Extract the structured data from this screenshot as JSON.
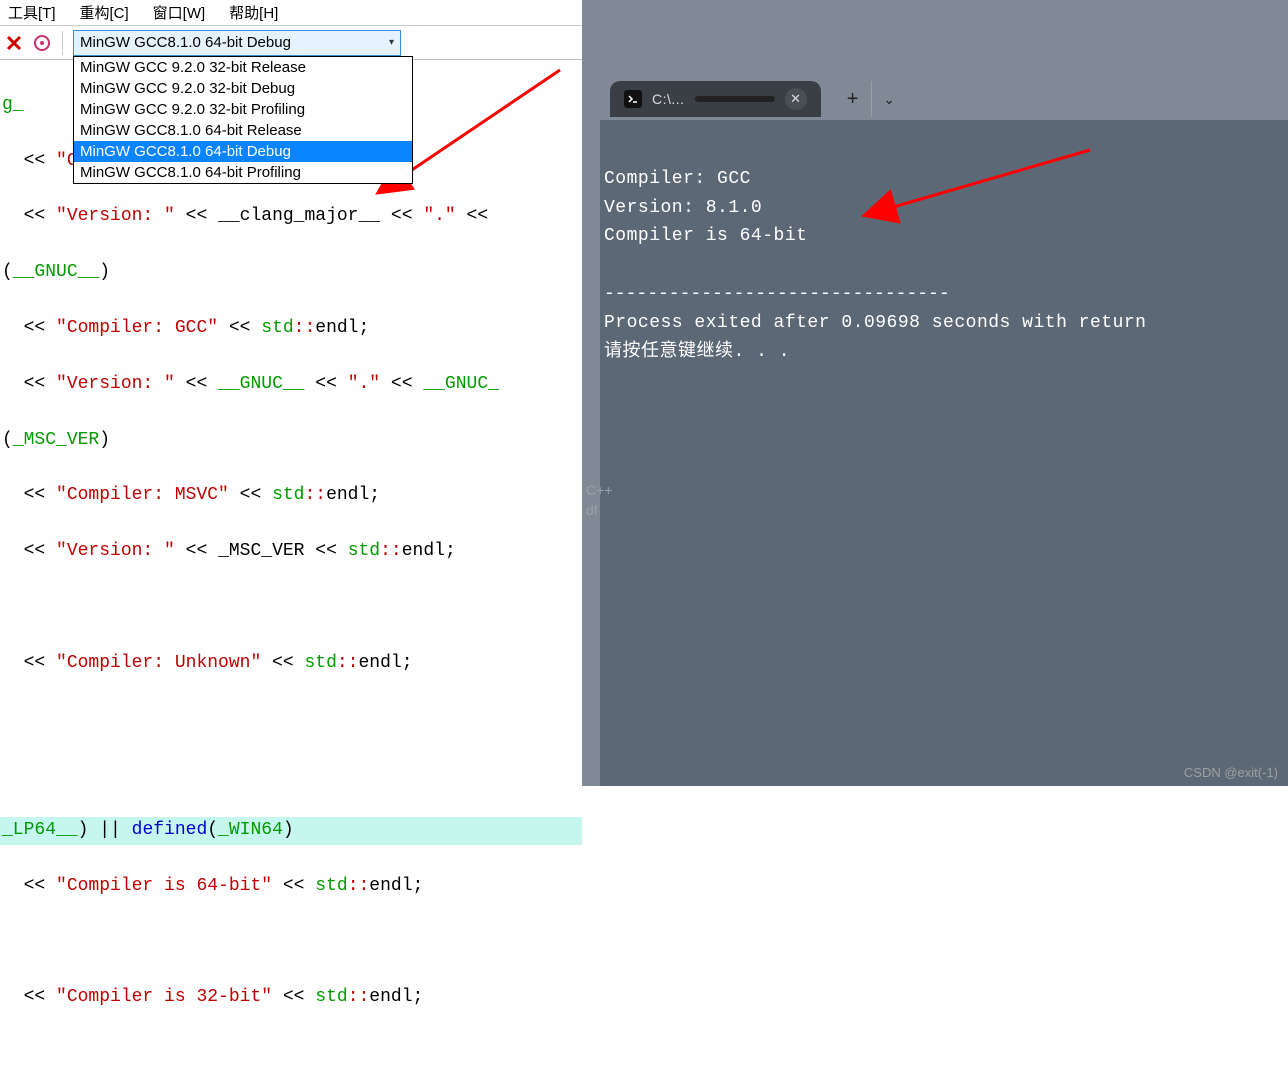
{
  "menubar": {
    "tools": "工具[T]",
    "refactor": "重构[C]",
    "window": "窗口[W]",
    "help": "帮助[H]"
  },
  "combo": {
    "selected": "MinGW GCC8.1.0 64-bit Debug",
    "options": [
      "MinGW GCC 9.2.0 32-bit Release",
      "MinGW GCC 9.2.0 32-bit Debug",
      "MinGW GCC 9.2.0 32-bit Profiling",
      "MinGW GCC8.1.0 64-bit Release",
      "MinGW GCC8.1.0 64-bit Debug",
      "MinGW GCC8.1.0 64-bit Profiling"
    ],
    "selected_index": 4
  },
  "code": {
    "frag_g": "g_",
    "l1_str": "\"Compiler: Clang\"",
    "l2_str": "\"Version: \"",
    "l2_id": "__clang_major__",
    "l2_dot": "\".\"",
    "gnuc": "__GNUC__",
    "l4_str": "\"Compiler: GCC\"",
    "l5_str": "\"Version: \"",
    "l5_dot": "\".\"",
    "l5_id2": "__GNUC_",
    "mscver": "_MSC_VER",
    "l7_str": "\"Compiler: MSVC\"",
    "l8_str": "\"Version: \"",
    "l8_id": "_MSC_VER",
    "l10_str": "\"Compiler: Unknown\"",
    "hl_lp64": "_LP64__",
    "hl_defined": "defined",
    "hl_win64": "_WIN64",
    "l12_str": "\"Compiler is 64-bit\"",
    "l14_str": "\"Compiler is 32-bit\"",
    "std": "std",
    "endl": "endl",
    "op_ins": " << ",
    "semi": ";",
    "parens_wrap_open": "(",
    "parens_wrap_close": ")"
  },
  "terminal": {
    "tab_title": "C:\\...",
    "line1": "Compiler: GCC",
    "line2": "Version: 8.1.0",
    "line3": "Compiler is 64-bit",
    "dashes": "--------------------------------",
    "process_line": "Process exited after 0.09698 seconds with return",
    "press_key": "请按任意键继续. . ."
  },
  "ghost": {
    "cpp": "C++",
    "df": "df"
  },
  "watermark": "CSDN @exit(-1)"
}
